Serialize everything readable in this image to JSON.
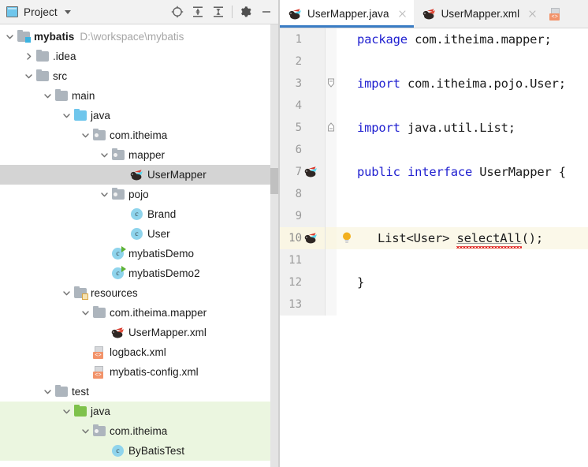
{
  "panel": {
    "title": "Project",
    "title_icon": "project-window-icon",
    "dropdown_icon": "chevron-down-icon",
    "tools": [
      {
        "name": "locate-icon",
        "title": "Select Opened File"
      },
      {
        "name": "expand-all-icon",
        "title": "Expand All"
      },
      {
        "name": "collapse-all-icon",
        "title": "Collapse All"
      },
      {
        "name": "gear-icon",
        "title": "Settings"
      },
      {
        "name": "minimize-icon",
        "title": "Hide"
      }
    ]
  },
  "tree": [
    {
      "label": "mybatis",
      "path": "D:\\workspace\\mybatis",
      "depth": 0,
      "icon": "module-folder-icon",
      "twisty": "expanded",
      "bold": true,
      "state": "none"
    },
    {
      "label": ".idea",
      "path": "",
      "depth": 1,
      "icon": "folder-icon",
      "twisty": "collapsed",
      "bold": false,
      "state": "none"
    },
    {
      "label": "src",
      "path": "",
      "depth": 1,
      "icon": "folder-icon",
      "twisty": "expanded",
      "bold": false,
      "state": "none"
    },
    {
      "label": "main",
      "path": "",
      "depth": 2,
      "icon": "folder-icon",
      "twisty": "expanded",
      "bold": false,
      "state": "none"
    },
    {
      "label": "java",
      "path": "",
      "depth": 3,
      "icon": "source-root-folder-icon",
      "twisty": "expanded",
      "bold": false,
      "state": "none"
    },
    {
      "label": "com.itheima",
      "path": "",
      "depth": 4,
      "icon": "package-folder-icon",
      "twisty": "expanded",
      "bold": false,
      "state": "none"
    },
    {
      "label": "mapper",
      "path": "",
      "depth": 5,
      "icon": "package-folder-icon",
      "twisty": "expanded",
      "bold": false,
      "state": "none"
    },
    {
      "label": "UserMapper",
      "path": "",
      "depth": 6,
      "icon": "mybatis-mapper-icon",
      "twisty": "none",
      "bold": false,
      "state": "selected"
    },
    {
      "label": "pojo",
      "path": "",
      "depth": 5,
      "icon": "package-folder-icon",
      "twisty": "expanded",
      "bold": false,
      "state": "none"
    },
    {
      "label": "Brand",
      "path": "",
      "depth": 6,
      "icon": "java-class-icon",
      "twisty": "none",
      "bold": false,
      "state": "none"
    },
    {
      "label": "User",
      "path": "",
      "depth": 6,
      "icon": "java-class-icon",
      "twisty": "none",
      "bold": false,
      "state": "none"
    },
    {
      "label": "mybatisDemo",
      "path": "",
      "depth": 5,
      "icon": "java-runnable-class-icon",
      "twisty": "none",
      "bold": false,
      "state": "none"
    },
    {
      "label": "mybatisDemo2",
      "path": "",
      "depth": 5,
      "icon": "java-runnable-class-icon",
      "twisty": "none",
      "bold": false,
      "state": "none"
    },
    {
      "label": "resources",
      "path": "",
      "depth": 3,
      "icon": "resource-root-folder-icon",
      "twisty": "expanded",
      "bold": false,
      "state": "none"
    },
    {
      "label": "com.itheima.mapper",
      "path": "",
      "depth": 4,
      "icon": "folder-icon",
      "twisty": "expanded",
      "bold": false,
      "state": "none"
    },
    {
      "label": "UserMapper.xml",
      "path": "",
      "depth": 5,
      "icon": "mybatis-mapper-xml-icon",
      "twisty": "none",
      "bold": false,
      "state": "none"
    },
    {
      "label": "logback.xml",
      "path": "",
      "depth": 4,
      "icon": "xml-file-icon",
      "twisty": "none",
      "bold": false,
      "state": "none"
    },
    {
      "label": "mybatis-config.xml",
      "path": "",
      "depth": 4,
      "icon": "xml-file-icon",
      "twisty": "none",
      "bold": false,
      "state": "none"
    },
    {
      "label": "test",
      "path": "",
      "depth": 2,
      "icon": "folder-icon",
      "twisty": "expanded",
      "bold": false,
      "state": "none"
    },
    {
      "label": "java",
      "path": "",
      "depth": 3,
      "icon": "test-source-root-folder-icon",
      "twisty": "expanded",
      "bold": false,
      "state": "highlighted"
    },
    {
      "label": "com.itheima",
      "path": "",
      "depth": 4,
      "icon": "package-folder-icon",
      "twisty": "expanded",
      "bold": false,
      "state": "highlighted"
    },
    {
      "label": "ByBatisTest",
      "path": "",
      "depth": 5,
      "icon": "java-class-icon",
      "twisty": "none",
      "bold": false,
      "state": "highlighted"
    }
  ],
  "editor": {
    "tabs": [
      {
        "label": "UserMapper.java",
        "icon": "mybatis-mapper-icon",
        "active": true,
        "close_icon": "close-icon"
      },
      {
        "label": "UserMapper.xml",
        "icon": "mybatis-mapper-xml-icon",
        "active": false,
        "close_icon": "close-icon"
      }
    ],
    "partial_tab_icon": "xml-file-icon",
    "caret_line": 10,
    "lines": [
      {
        "num": "1",
        "gutter_icon": "",
        "fold": "",
        "bulb": false,
        "tokens": [
          {
            "t": "kw",
            "v": "package"
          },
          {
            "t": "sp",
            "v": " "
          },
          {
            "t": "id",
            "v": "com.itheima.mapper;"
          }
        ]
      },
      {
        "num": "2",
        "gutter_icon": "",
        "fold": "",
        "bulb": false,
        "tokens": []
      },
      {
        "num": "3",
        "gutter_icon": "",
        "fold": "fold-end",
        "bulb": false,
        "tokens": [
          {
            "t": "kw",
            "v": "import"
          },
          {
            "t": "sp",
            "v": " "
          },
          {
            "t": "id",
            "v": "com.itheima.pojo.User;"
          }
        ]
      },
      {
        "num": "4",
        "gutter_icon": "",
        "fold": "",
        "bulb": false,
        "tokens": []
      },
      {
        "num": "5",
        "gutter_icon": "",
        "fold": "fold-start",
        "bulb": false,
        "tokens": [
          {
            "t": "kw",
            "v": "import"
          },
          {
            "t": "sp",
            "v": " "
          },
          {
            "t": "id",
            "v": "java.util.List;"
          }
        ]
      },
      {
        "num": "6",
        "gutter_icon": "",
        "fold": "",
        "bulb": false,
        "tokens": []
      },
      {
        "num": "7",
        "gutter_icon": "mybatis-mapper-icon",
        "fold": "",
        "bulb": false,
        "tokens": [
          {
            "t": "kw",
            "v": "public"
          },
          {
            "t": "sp",
            "v": " "
          },
          {
            "t": "kw",
            "v": "interface"
          },
          {
            "t": "sp",
            "v": " "
          },
          {
            "t": "id",
            "v": "UserMapper {"
          }
        ]
      },
      {
        "num": "8",
        "gutter_icon": "",
        "fold": "",
        "bulb": false,
        "tokens": []
      },
      {
        "num": "9",
        "gutter_icon": "",
        "fold": "",
        "bulb": false,
        "tokens": []
      },
      {
        "num": "10",
        "gutter_icon": "mybatis-mapper-icon",
        "fold": "",
        "bulb": true,
        "tokens": [
          {
            "t": "id",
            "v": "List<User> "
          },
          {
            "t": "err",
            "v": "selectAll"
          },
          {
            "t": "id",
            "v": "();"
          }
        ]
      },
      {
        "num": "11",
        "gutter_icon": "",
        "fold": "",
        "bulb": false,
        "tokens": []
      },
      {
        "num": "12",
        "gutter_icon": "",
        "fold": "",
        "bulb": false,
        "tokens": [
          {
            "t": "id",
            "v": "}"
          }
        ]
      },
      {
        "num": "13",
        "gutter_icon": "",
        "fold": "",
        "bulb": false,
        "tokens": []
      }
    ]
  },
  "colors": {
    "accent_tab_underline": "#3a7cc4",
    "selection_gray": "#d4d4d4",
    "test_highlight_green": "#ebf6e0",
    "caret_line_yellow": "#fbf8e9",
    "keyword_blue": "#2020d0",
    "error_red": "#e02020",
    "folder_gray": "#adb5bd",
    "source_folder_blue": "#6fc6ec",
    "test_folder_green": "#7ec24b",
    "class_icon_blue": "#8fd4ec"
  }
}
